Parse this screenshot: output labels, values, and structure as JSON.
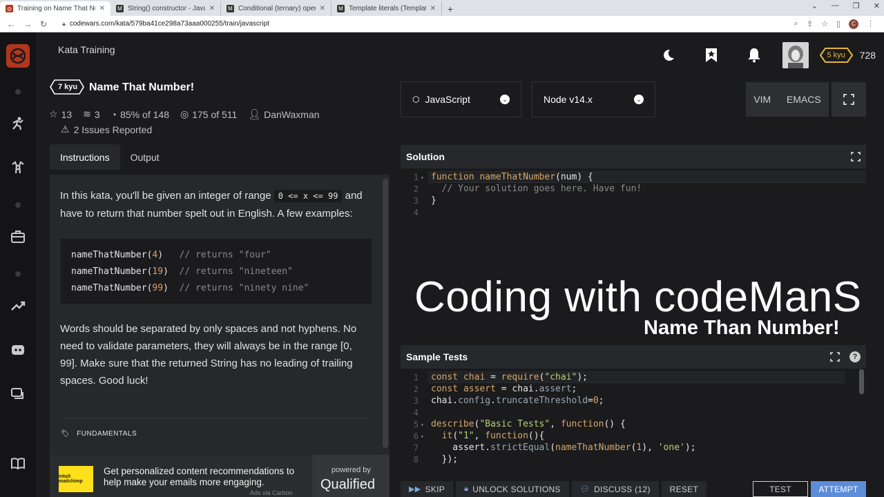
{
  "browser": {
    "tabs": [
      {
        "title": "Training on Name That Number!",
        "favicon": "codewars",
        "active": true
      },
      {
        "title": "String() constructor - JavaScript",
        "favicon": "M",
        "active": false
      },
      {
        "title": "Conditional (ternary) operator -",
        "favicon": "M",
        "active": false
      },
      {
        "title": "Template literals (Template string",
        "favicon": "M",
        "active": false
      }
    ],
    "url": "codewars.com/kata/579ba41ce298a73aaa000255/train/javascript",
    "profile_initial": "C"
  },
  "app": {
    "page_title": "Kata Training",
    "rank": "5 kyu",
    "honor": "728"
  },
  "kata": {
    "kyu": "7 kyu",
    "title": "Name That Number!",
    "stats": {
      "stars": "13",
      "collections": "3",
      "satisfaction": "85% of 148",
      "completed": "175 of 511",
      "author": "DanWaxman"
    },
    "issues": "2 Issues Reported",
    "tabs": [
      "Instructions",
      "Output"
    ],
    "instructions": {
      "p1_a": "In this kata, you'll be given an integer of range",
      "p1_code": "0 <= x <= 99",
      "p1_b": "and",
      "p1_c": "have to return that number spelt out in English. A few examples:",
      "examples": [
        {
          "call": "nameThatNumber(",
          "arg": "4",
          "close": ")",
          "pad": "   ",
          "comment": "// returns \"four\""
        },
        {
          "call": "nameThatNumber(",
          "arg": "19",
          "close": ")",
          "pad": "  ",
          "comment": "// returns \"nineteen\""
        },
        {
          "call": "nameThatNumber(",
          "arg": "99",
          "close": ")",
          "pad": "  ",
          "comment": "// returns \"ninety nine\""
        }
      ],
      "p2_lines": [
        "Words should be separated by only spaces and not hyphens. No",
        "need to validate parameters, they will always be in the range [0,",
        "99]. Make sure that the returned String has no leading of trailing",
        "spaces. Good luck!"
      ],
      "tag": "FUNDAMENTALS"
    },
    "ad": {
      "logo": "intuit mailchimp",
      "text": "Get personalized content recommendations to help make your emails more engaging.",
      "via": "Ads via Carbon",
      "powered_by": "powered by",
      "brand": "Qualified"
    }
  },
  "editor": {
    "language": "JavaScript",
    "version": "Node v14.x",
    "modes": [
      "VIM",
      "EMACS"
    ],
    "solution_title": "Solution",
    "sample_tests_title": "Sample Tests",
    "overlay": {
      "big": "Coding with codeManS",
      "small": "Name Than Number!"
    },
    "bottom": {
      "skip": "SKIP",
      "unlock": "UNLOCK SOLUTIONS",
      "discuss": "DISCUSS (12)",
      "reset": "RESET",
      "test": "TEST",
      "attempt": "ATTEMPT"
    }
  }
}
